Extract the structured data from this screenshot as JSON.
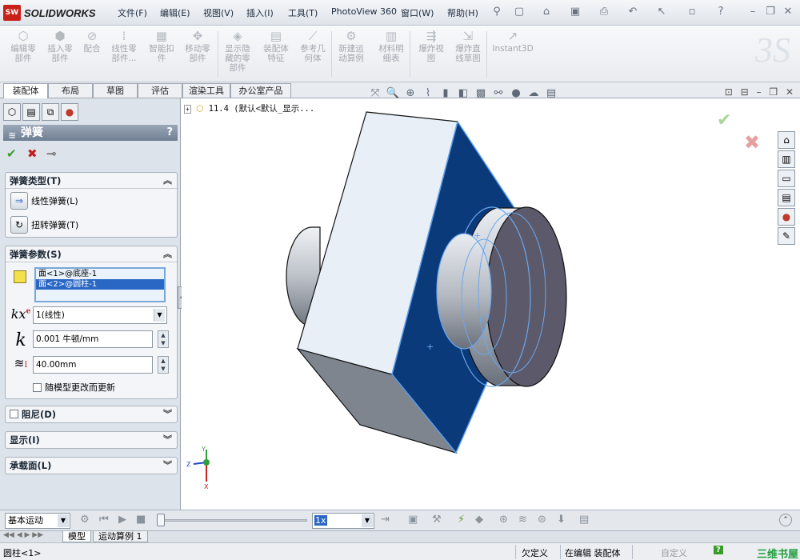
{
  "app": {
    "logo_mark": "SW",
    "logo_text": "SOLIDWORKS"
  },
  "menu": [
    "文件(F)",
    "编辑(E)",
    "视图(V)",
    "插入(I)",
    "工具(T)",
    "PhotoView 360",
    "窗口(W)",
    "帮助(H)"
  ],
  "ribbon": [
    "编辑零\n部件",
    "插入零\n部件",
    "配合",
    "线性零\n部件...",
    "智能扣\n件",
    "移动零\n部件",
    "显示隐\n藏的零\n部件",
    "装配体\n特征",
    "参考几\n何体",
    "新建运\n动算例",
    "材料明\n细表",
    "爆炸视\n图",
    "爆炸直\n线草图",
    "Instant3D"
  ],
  "tabs": [
    "装配体",
    "布局",
    "草图",
    "评估",
    "渲染工具",
    "办公室产品"
  ],
  "property_manager": {
    "title": "弹簧",
    "help": "?",
    "spring_type": {
      "header": "弹簧类型(T)",
      "linear": "线性弹簧(L)",
      "torsion": "扭转弹簧(T)"
    },
    "spring_params": {
      "header": "弹簧参数(S)",
      "selections": [
        "面<1>@底座-1",
        "面<2>@圆柱-1"
      ],
      "exponent_label": "kx",
      "exponent_sup": "e",
      "exponent_value": "1(线性)",
      "k_label": "k",
      "k_value": "0.001 牛顿/mm",
      "length_value": "40.00mm",
      "update_label": "随模型更改而更新"
    },
    "damper_header": "阻尼(D)",
    "display_header": "显示(I)",
    "load_header": "承载面(L)"
  },
  "tree": {
    "node": "11.4   (默认<默认_显示...",
    "expand": "+"
  },
  "triad": {
    "y": "Y",
    "z": "Z",
    "x": "X"
  },
  "motion": {
    "study_type": "基本运动",
    "speed": "1x"
  },
  "bottom_tabs": [
    "模型",
    "运动算例 1"
  ],
  "status": {
    "selection": "圆柱<1>",
    "definition": "欠定义",
    "mode": "在编辑 装配体",
    "units": "自定义",
    "help_btn": "?",
    "brand": "三维书屋"
  },
  "colors": {
    "face_dark": "#0b3a7a",
    "face_light": "#e9eff7",
    "face_side": "#7e858e",
    "cylinder_end": "#5c5a6a",
    "selection_blue": "#2a66c4",
    "ok_green": "#3a9b2a",
    "cancel_red": "#c02020"
  }
}
